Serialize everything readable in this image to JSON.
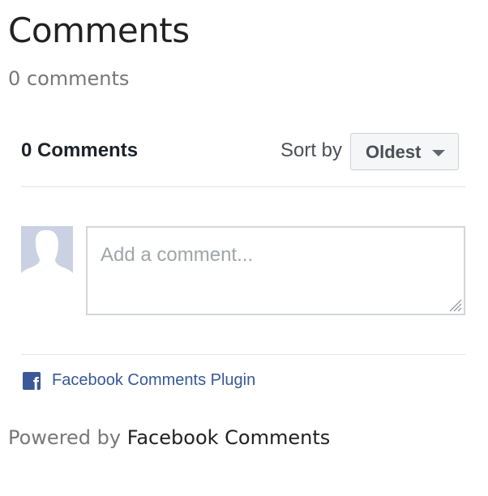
{
  "page": {
    "title": "Comments",
    "comment_count_text": "0 comments"
  },
  "plugin": {
    "count_label": "0 Comments",
    "sort": {
      "label": "Sort by",
      "selected": "Oldest"
    },
    "composer": {
      "placeholder": "Add a comment...",
      "value": ""
    },
    "footer": {
      "link_text": "Facebook Comments Plugin",
      "logo_icon": "facebook-logo-icon",
      "logo_color": "#3b5998"
    }
  },
  "powered_by": {
    "prefix": "Powered by",
    "link_text": "Facebook Comments"
  },
  "colors": {
    "link_blue": "#365899",
    "avatar_bg": "#c9d1e3"
  }
}
